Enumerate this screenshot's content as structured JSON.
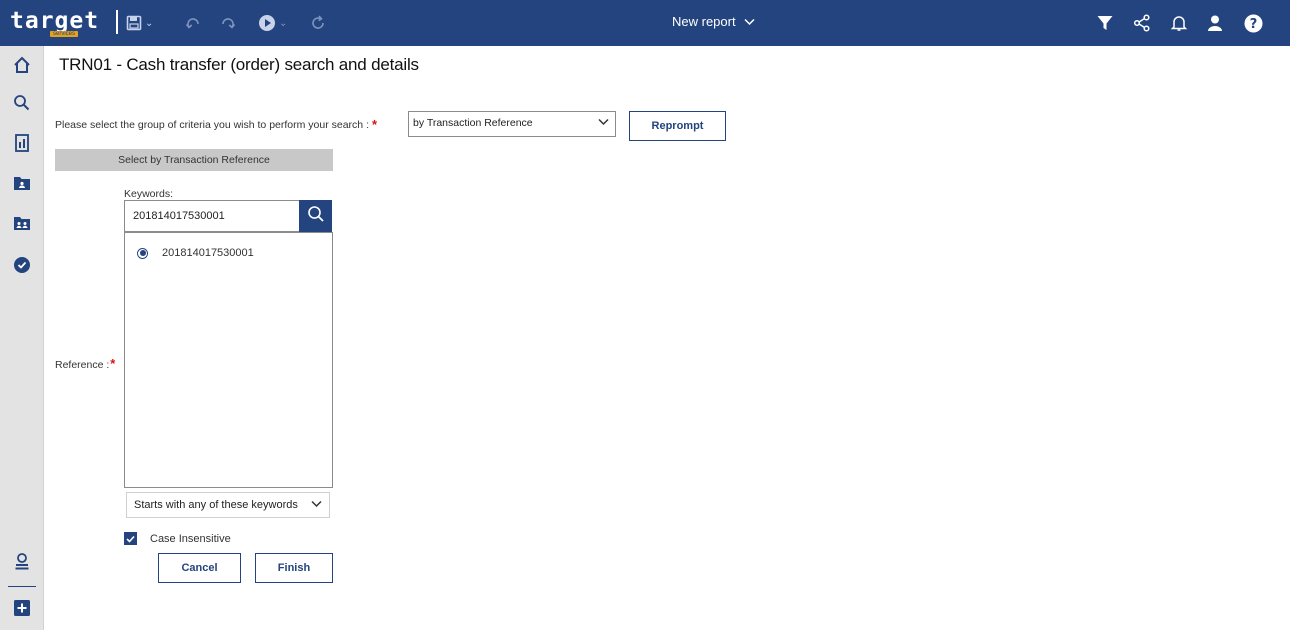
{
  "topbar": {
    "logo_text": "target",
    "logo_sub": "services",
    "report_title": "New report"
  },
  "page": {
    "title": "TRN01 - Cash transfer (order) search and details"
  },
  "criteria": {
    "prompt_label": "Please select the group of criteria you wish to perform your search :",
    "required_mark": "*",
    "selected_value": "by Transaction Reference",
    "reprompt_label": "Reprompt"
  },
  "section": {
    "header": "Select by Transaction Reference"
  },
  "search": {
    "keywords_label": "Keywords:",
    "keywords_value": "201814017530001",
    "results": [
      {
        "label": "201814017530001",
        "selected": true
      }
    ],
    "match_mode": "Starts with any of these keywords",
    "case_insensitive_label": "Case Insensitive",
    "case_insensitive_checked": true
  },
  "reference": {
    "label": "Reference :",
    "required_mark": "*"
  },
  "actions": {
    "cancel_label": "Cancel",
    "finish_label": "Finish"
  },
  "colors": {
    "brand_blue": "#24447f",
    "required_red": "#dd1111",
    "logo_accent": "#e6a21b"
  },
  "icons": {
    "topbar_left": [
      "save-icon",
      "undo-icon",
      "redo-icon",
      "run-icon",
      "refresh-icon"
    ],
    "topbar_right": [
      "filter-icon",
      "share-icon",
      "bell-icon",
      "user-icon",
      "help-icon"
    ],
    "rail": [
      "home-icon",
      "search-icon",
      "report-icon",
      "team-folder-icon",
      "shared-folder-icon",
      "schedule-icon",
      "account-icon",
      "add-icon"
    ]
  }
}
